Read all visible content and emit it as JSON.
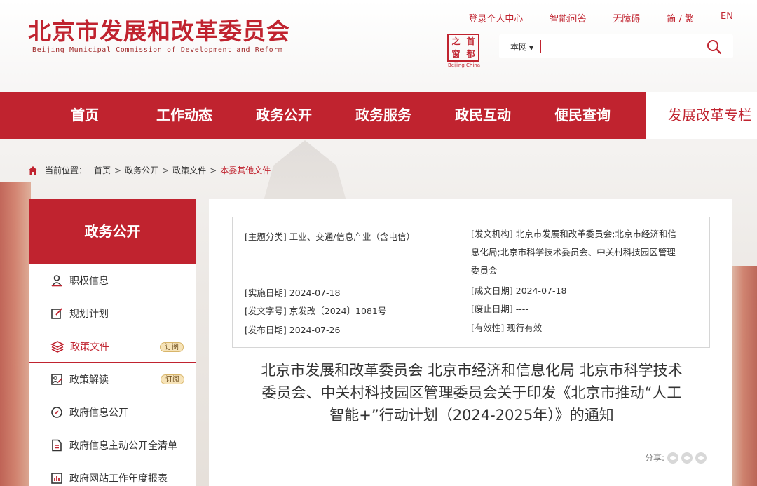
{
  "site": {
    "title": "北京市发展和改革委员会",
    "subtitle": "Beijing Municipal Commission of Development and Reform",
    "seal_chars": [
      "之",
      "首",
      "窗",
      "都"
    ],
    "seal_caption": "Beijing·China"
  },
  "top_links": [
    "登录个人中心",
    "智能问答",
    "无障碍",
    "简 / 繁",
    "EN"
  ],
  "search": {
    "scope": "本网",
    "value": "",
    "placeholder": ""
  },
  "nav": {
    "items": [
      "首页",
      "工作动态",
      "政务公开",
      "政务服务",
      "政民互动",
      "便民查询"
    ],
    "active_item": "发展改革专栏"
  },
  "breadcrumb": {
    "label": "当前位置：",
    "items": [
      "首页",
      "政务公开",
      "政策文件"
    ],
    "current": "本委其他文件"
  },
  "sidebar": {
    "title": "政务公开",
    "items": [
      {
        "label": "职权信息",
        "icon": "person-icon",
        "badge": ""
      },
      {
        "label": "规划计划",
        "icon": "edit-icon",
        "badge": ""
      },
      {
        "label": "政策文件",
        "icon": "layers-icon",
        "badge": "订阅"
      },
      {
        "label": "政策解读",
        "icon": "user-edit-icon",
        "badge": "订阅"
      },
      {
        "label": "政府信息公开",
        "icon": "compass-icon",
        "badge": ""
      },
      {
        "label": "政府信息主动公开全清单",
        "icon": "document-icon",
        "badge": ""
      },
      {
        "label": "政府网站工作年度报表",
        "icon": "report-icon",
        "badge": ""
      }
    ]
  },
  "meta": {
    "left": [
      {
        "label": "[主题分类]",
        "value": "工业、交通/信息产业（含电信）"
      },
      {
        "label": "[实施日期]",
        "value": "2024-07-18"
      },
      {
        "label": "[发文字号]",
        "value": "京发改〔2024〕1081号"
      },
      {
        "label": "[发布日期]",
        "value": "2024-07-26"
      }
    ],
    "right": [
      {
        "label": "[发文机构]",
        "value": "北京市发展和改革委员会;北京市经济和信",
        "line2": "息化局;北京市科学技术委员会、中关村科技园区管理",
        "line3": "委员会"
      },
      {
        "label": "[成文日期]",
        "value": "2024-07-18"
      },
      {
        "label": "[废止日期]",
        "value": "----"
      },
      {
        "label": "[有效性]",
        "value": "现行有效"
      }
    ]
  },
  "document": {
    "title_line1": "北京市发展和改革委员会 北京市经济和信息化局 北京市科学技术",
    "title_line2": "委员会、中关村科技园区管理委员会关于印发《北京市推动“人工",
    "title_line3": "智能+”行动计划（2024-2025年）》的通知"
  },
  "share": {
    "label": "分享:",
    "icons": [
      "weibo-icon",
      "wechat-icon",
      "qzone-icon"
    ]
  },
  "colors": {
    "brand_red": "#c0232f",
    "badge_bg": "#f6e3b8"
  }
}
